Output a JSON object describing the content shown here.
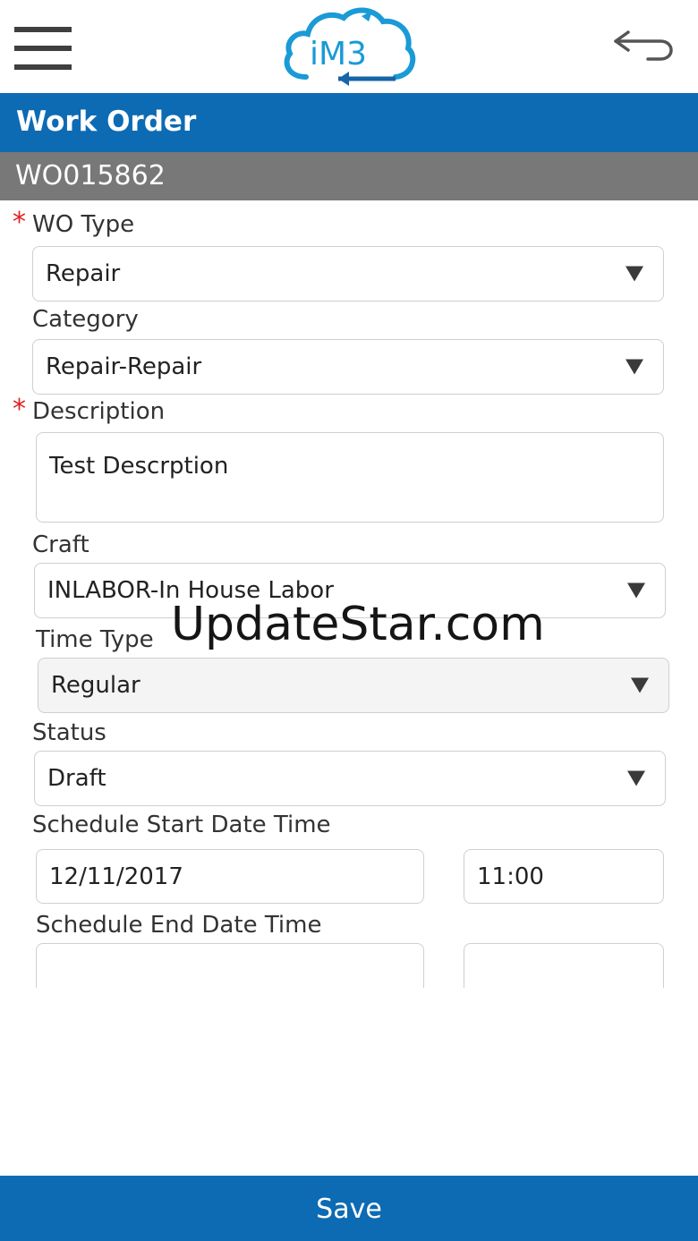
{
  "header": {
    "logo_text": "iM3",
    "menu_icon": "hamburger-menu-icon",
    "back_icon": "back-arrow-icon"
  },
  "page": {
    "title": "Work Order",
    "wo_number": "WO015862"
  },
  "form": {
    "wo_type": {
      "label": "WO Type",
      "required_mark": "*",
      "value": "Repair"
    },
    "category": {
      "label": "Category",
      "value": "Repair-Repair"
    },
    "description": {
      "label": "Description",
      "required_mark": "*",
      "value": "Test Descrption"
    },
    "craft": {
      "label": "Craft",
      "value": "INLABOR-In House Labor"
    },
    "time_type": {
      "label": "Time Type",
      "value": "Regular"
    },
    "status": {
      "label": "Status",
      "value": "Draft"
    },
    "schedule_start": {
      "label": "Schedule Start Date Time",
      "date": "12/11/2017",
      "time": "11:00"
    },
    "schedule_end": {
      "label": "Schedule End Date Time",
      "date": "",
      "time": ""
    }
  },
  "watermark": "UpdateStar.com",
  "footer": {
    "save_label": "Save"
  },
  "colors": {
    "primary": "#0d6bb3",
    "subheader": "#787878",
    "required": "#e02020",
    "logo_blue": "#1a9ad6",
    "logo_red": "#e53935"
  }
}
